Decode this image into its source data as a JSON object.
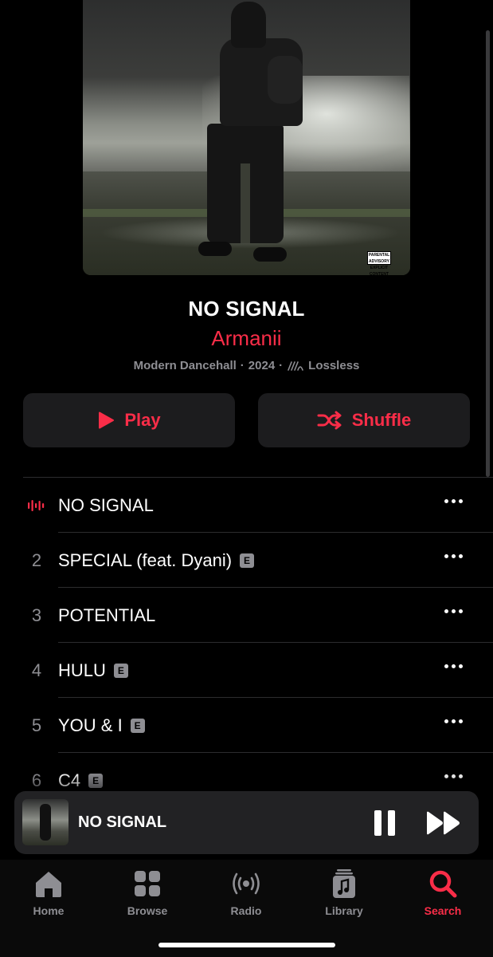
{
  "album": {
    "title": "NO SIGNAL",
    "artist": "Armanii",
    "genre": "Modern Dancehall",
    "year": "2024",
    "quality": "Lossless",
    "advisory_label": "PARENTAL ADVISORY EXPLICIT CONTENT"
  },
  "actions": {
    "play_label": "Play",
    "shuffle_label": "Shuffle"
  },
  "tracks": [
    {
      "number": "",
      "title": "NO SIGNAL",
      "explicit": false,
      "playing": true
    },
    {
      "number": "2",
      "title": "SPECIAL (feat. Dyani)",
      "explicit": true,
      "playing": false
    },
    {
      "number": "3",
      "title": "POTENTIAL",
      "explicit": false,
      "playing": false
    },
    {
      "number": "4",
      "title": "HULU",
      "explicit": true,
      "playing": false
    },
    {
      "number": "5",
      "title": "YOU & I",
      "explicit": true,
      "playing": false
    },
    {
      "number": "6",
      "title": "C4",
      "explicit": true,
      "playing": false
    }
  ],
  "explicit_badge": "E",
  "mini_player": {
    "title": "NO SIGNAL",
    "state": "playing"
  },
  "tabs": [
    {
      "label": "Home",
      "icon": "home-icon",
      "active": false
    },
    {
      "label": "Browse",
      "icon": "grid-icon",
      "active": false
    },
    {
      "label": "Radio",
      "icon": "radio-icon",
      "active": false
    },
    {
      "label": "Library",
      "icon": "library-icon",
      "active": false
    },
    {
      "label": "Search",
      "icon": "search-icon",
      "active": true
    }
  ],
  "colors": {
    "accent": "#fa2d48",
    "background": "#000000",
    "secondary_text": "#8e8e93",
    "button_bg": "#1c1c1e"
  }
}
